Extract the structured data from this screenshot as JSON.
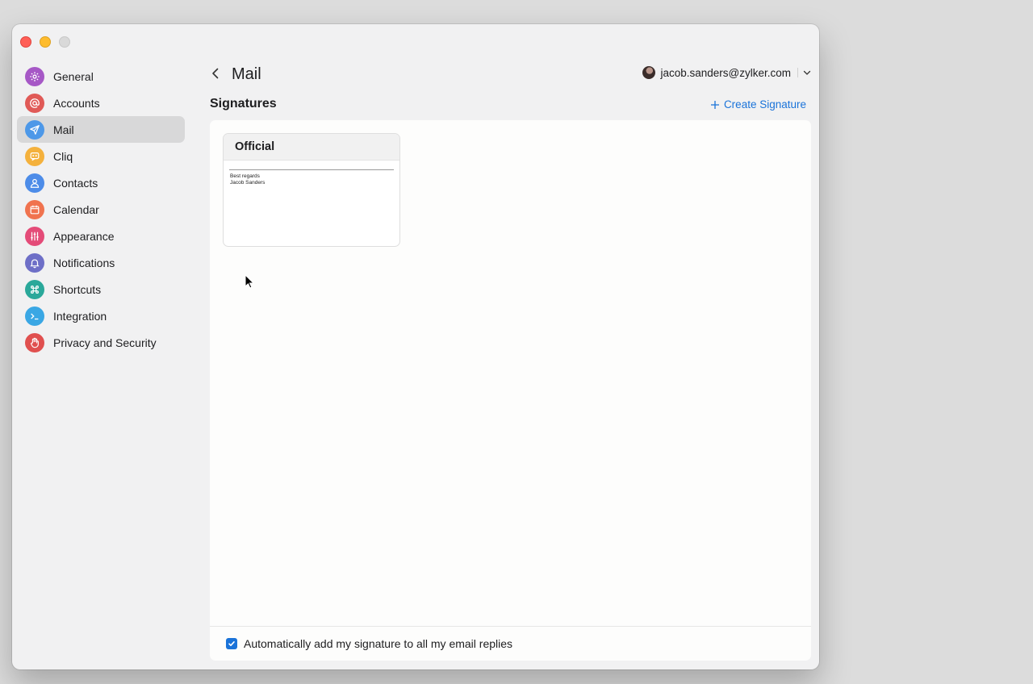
{
  "window": {
    "controls": [
      "close",
      "minimize",
      "maximize"
    ]
  },
  "sidebar": {
    "items": [
      {
        "label": "General",
        "icon": "gear-icon",
        "color": "#a658c6",
        "active": false
      },
      {
        "label": "Accounts",
        "icon": "at-icon",
        "color": "#e05a57",
        "active": false
      },
      {
        "label": "Mail",
        "icon": "paper-plane-icon",
        "color": "#4d98e8",
        "active": true
      },
      {
        "label": "Cliq",
        "icon": "chat-bubble-icon",
        "color": "#f4b13d",
        "active": false
      },
      {
        "label": "Contacts",
        "icon": "person-icon",
        "color": "#4d8ce8",
        "active": false
      },
      {
        "label": "Calendar",
        "icon": "calendar-icon",
        "color": "#f0734f",
        "active": false
      },
      {
        "label": "Appearance",
        "icon": "sliders-icon",
        "color": "#e44b78",
        "active": false
      },
      {
        "label": "Notifications",
        "icon": "bell-icon",
        "color": "#6e6fc7",
        "active": false
      },
      {
        "label": "Shortcuts",
        "icon": "command-icon",
        "color": "#2aa89a",
        "active": false
      },
      {
        "label": "Integration",
        "icon": "terminal-icon",
        "color": "#3aa7e4",
        "active": false
      },
      {
        "label": "Privacy and Security",
        "icon": "hand-icon",
        "color": "#e0504f",
        "active": false
      }
    ]
  },
  "header": {
    "title": "Mail",
    "account_email": "jacob.sanders@zylker.com"
  },
  "signatures": {
    "section_title": "Signatures",
    "create_label": "Create Signature",
    "cards": [
      {
        "name": "Official",
        "lines": [
          "Best regards",
          "Jacob Sanders"
        ]
      }
    ]
  },
  "footer": {
    "auto_add_label": "Automatically add my signature to all my email replies",
    "auto_add_checked": true
  },
  "colors": {
    "accent": "#1a73d9",
    "sidebar_active": "#d8d8d9"
  }
}
